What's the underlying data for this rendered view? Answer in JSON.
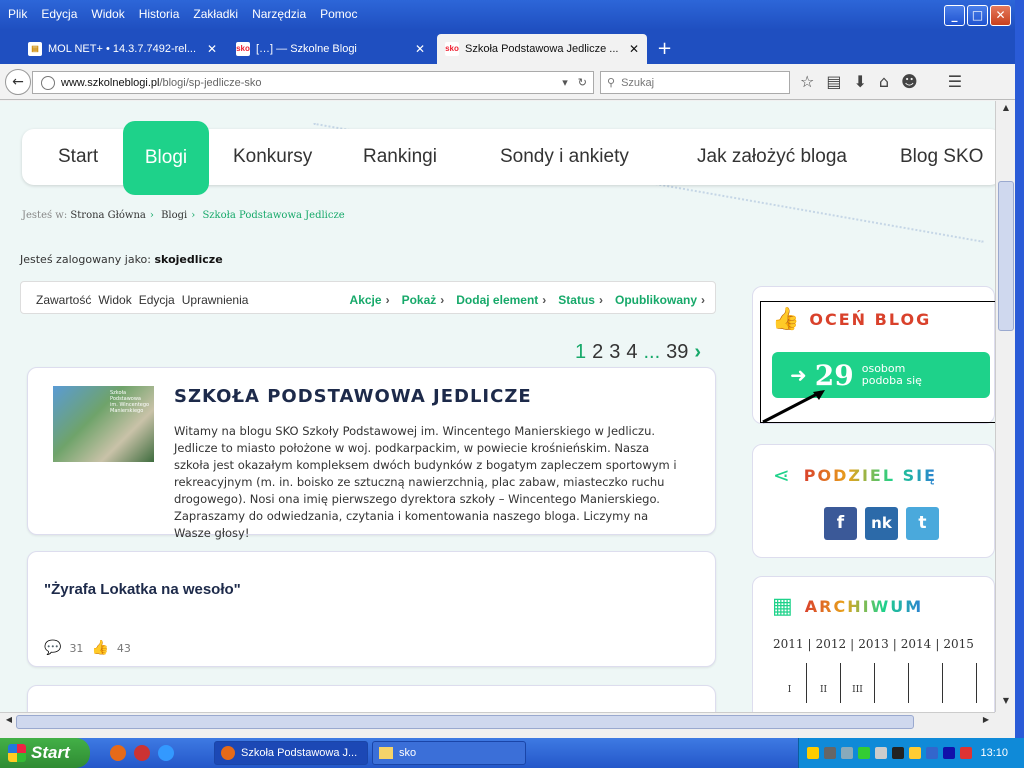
{
  "window": {
    "menus": [
      "Plik",
      "Edycja",
      "Widok",
      "Historia",
      "Zakładki",
      "Narzędzia",
      "Pomoc"
    ],
    "controls": {
      "minimize": "_",
      "maximize": "□",
      "close": "✕"
    }
  },
  "tabs": [
    {
      "label": "MOL NET+ • 14.3.7.7492-rel...",
      "close": "✕"
    },
    {
      "label": "[…] — Szkolne Blogi",
      "close": "✕"
    },
    {
      "label": "Szkoła Podstawowa Jedlicze ...",
      "close": "✕"
    }
  ],
  "new_tab": "+",
  "navbar": {
    "url_domain": "www.szkolneblogi.pl",
    "url_path": "/blogi/sp-jedlicze-sko",
    "search_placeholder": "Szukaj"
  },
  "site_nav": [
    "Start",
    "Blogi",
    "Konkursy",
    "Rankingi",
    "Sondy i ankiety",
    "Jak założyć bloga",
    "Blog SKO"
  ],
  "breadcrumb": {
    "prefix": "Jesteś w:",
    "items": [
      "Strona Główna",
      "Blogi",
      "Szkoła Podstawowa Jedlicze"
    ]
  },
  "logged_in": {
    "prefix": "Jesteś zalogowany jako:",
    "user": "skojedlicze"
  },
  "toolbar": {
    "left": [
      "Zawartość",
      "Widok",
      "Edycja",
      "Uprawnienia"
    ],
    "right": [
      "Akcje",
      "Pokaż",
      "Dodaj element",
      "Status",
      "Opublikowany"
    ]
  },
  "pagination": {
    "pages": [
      "1",
      "2",
      "3",
      "4"
    ],
    "ellipsis": "...",
    "last": "39",
    "next": "›"
  },
  "intro": {
    "title": "SZKOŁA PODSTAWOWA JEDLICZE",
    "thumb_text": "Szkoła Podstawowa im. Wincentego Manierskiego",
    "text": "Witamy na blogu SKO Szkoły Podstawowej im. Wincentego Manierskiego w Jedliczu. Jedlicze to miasto położone w woj. podkarpackim, w powiecie krośnieńskim. Nasza szkoła jest okazałym kompleksem dwóch budynków z bogatym zapleczem sportowym i rekreacyjnym (m. in. boisko ze sztuczną nawierzchnią, plac zabaw, miasteczko ruchu drogowego). Nosi ona imię pierwszego dyrektora szkoły – Wincentego Manierskiego. Zapraszamy do odwiedzania, czytania i komentowania naszego bloga. Liczymy na Wasze głosy!"
  },
  "post": {
    "title": "\"Żyrafa Lokatka na wesoło\"",
    "comments": "31",
    "likes": "43"
  },
  "rate": {
    "title": "OCEŃ BLOG",
    "count": "29",
    "label_line1": "osobom",
    "label_line2": "podoba się"
  },
  "share": {
    "title": "PODZIEL SIĘ",
    "fb": "f",
    "nk": "nk",
    "tw": "t"
  },
  "archive": {
    "title": "ARCHIWUM",
    "years": [
      "2011",
      "2012",
      "2013",
      "2014",
      "2015"
    ],
    "months": [
      "I",
      "II",
      "III",
      "",
      "",
      "",
      ""
    ]
  },
  "taskbar": {
    "start": "Start",
    "tasks": [
      "Szkoła Podstawowa J...",
      "sko"
    ],
    "clock": "13:10"
  },
  "colors": {
    "accent": "#1ed28a",
    "title_red": "#d9412b",
    "xp_blue": "#2457c9"
  }
}
